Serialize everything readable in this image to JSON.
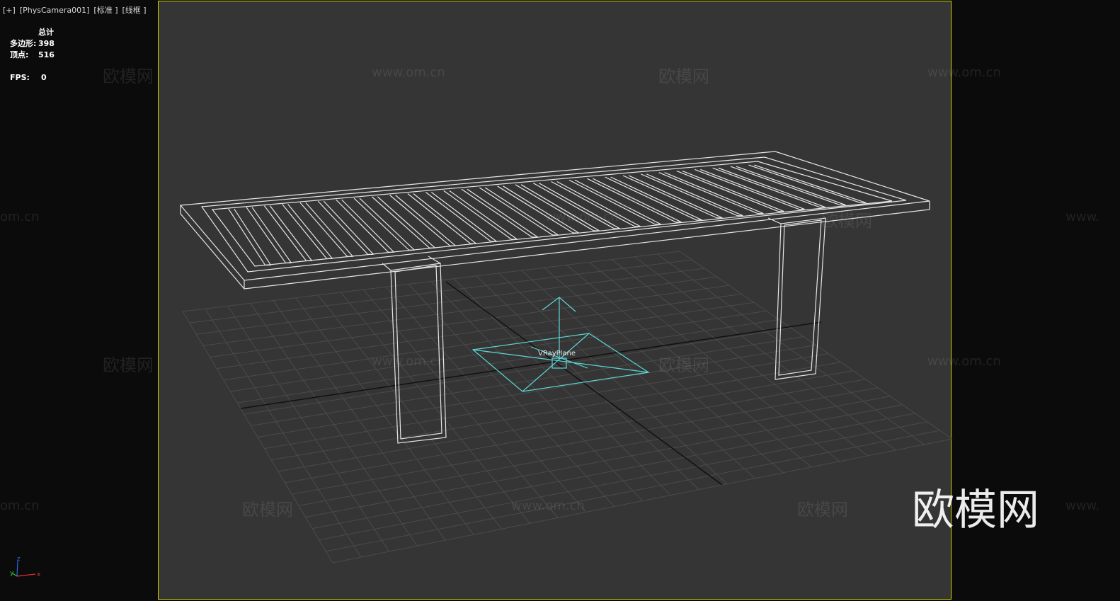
{
  "viewport": {
    "plus": "[+]",
    "camera": "[PhysCamera001]",
    "shading": "[标准 ]",
    "mode": "[线框 ]"
  },
  "stats": {
    "header": "总计",
    "polygons_label": "多边形:",
    "polygons_value": "398",
    "vertices_label": "顶点:",
    "vertices_value": "516",
    "fps_label": "FPS:",
    "fps_value": "0"
  },
  "object_label": "VRayPlane",
  "axis": {
    "x": "x",
    "y": "y",
    "z": "z"
  },
  "watermarks": {
    "brand": "欧模网",
    "url": "www.om.cn",
    "url_partial": "om.cn",
    "url_prefix": "www."
  },
  "colors": {
    "frame": "#d9d200",
    "viewport_bg": "#353535",
    "wire": "#e6e6e6",
    "light": "#5fd6d6",
    "grid": "#4a4a4a"
  }
}
